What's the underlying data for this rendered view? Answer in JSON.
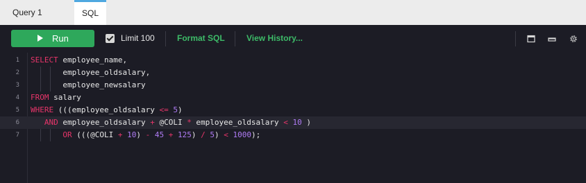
{
  "tabs": [
    {
      "label": "Query 1",
      "active": false
    },
    {
      "label": "SQL",
      "active": true
    }
  ],
  "toolbar": {
    "run_label": "Run",
    "limit_checked": true,
    "limit_label": "Limit 100",
    "format_label": "Format SQL",
    "history_label": "View History...",
    "icons": [
      "maximize-icon",
      "minimize-icon",
      "settings-gear-icon"
    ]
  },
  "colors": {
    "run_button": "#2ea85b",
    "link": "#3dbb68",
    "keyword": "#e8356a",
    "number": "#b07cf5",
    "tab_accent": "#4fa8e0",
    "editor_bg": "#1c1c25"
  },
  "editor": {
    "active_line": 6,
    "lines": [
      {
        "n": "1",
        "tokens": [
          [
            "kw",
            "SELECT"
          ],
          [
            "id",
            " employee_name,"
          ]
        ]
      },
      {
        "n": "2",
        "tokens": [
          [
            "id",
            "       employee_oldsalary,"
          ]
        ]
      },
      {
        "n": "3",
        "tokens": [
          [
            "id",
            "       employee_newsalary"
          ]
        ]
      },
      {
        "n": "4",
        "tokens": [
          [
            "kw",
            "FROM"
          ],
          [
            "id",
            " salary"
          ]
        ]
      },
      {
        "n": "5",
        "tokens": [
          [
            "kw",
            "WHERE"
          ],
          [
            "id",
            " (((employee_oldsalary "
          ],
          [
            "op",
            "<="
          ],
          [
            "id",
            " "
          ],
          [
            "num",
            "5"
          ],
          [
            "id",
            ")"
          ]
        ]
      },
      {
        "n": "6",
        "tokens": [
          [
            "id",
            "   "
          ],
          [
            "kw",
            "AND"
          ],
          [
            "id",
            " employee_oldsalary "
          ],
          [
            "op",
            "+"
          ],
          [
            "id",
            " @COLI "
          ],
          [
            "op",
            "*"
          ],
          [
            "id",
            " employee_oldsalary "
          ],
          [
            "op",
            "<"
          ],
          [
            "id",
            " "
          ],
          [
            "num",
            "10"
          ],
          [
            "id",
            " )"
          ]
        ]
      },
      {
        "n": "7",
        "tokens": [
          [
            "id",
            "       "
          ],
          [
            "kw",
            "OR"
          ],
          [
            "id",
            " (((@COLI "
          ],
          [
            "op",
            "+"
          ],
          [
            "id",
            " "
          ],
          [
            "num",
            "10"
          ],
          [
            "id",
            ") "
          ],
          [
            "op",
            "-"
          ],
          [
            "id",
            " "
          ],
          [
            "num",
            "45"
          ],
          [
            "id",
            " "
          ],
          [
            "op",
            "+"
          ],
          [
            "id",
            " "
          ],
          [
            "num",
            "125"
          ],
          [
            "id",
            ") "
          ],
          [
            "op",
            "/"
          ],
          [
            "id",
            " "
          ],
          [
            "num",
            "5"
          ],
          [
            "id",
            ") "
          ],
          [
            "op",
            "<"
          ],
          [
            "id",
            " "
          ],
          [
            "num",
            "1000"
          ],
          [
            "id",
            ");"
          ]
        ]
      }
    ]
  }
}
